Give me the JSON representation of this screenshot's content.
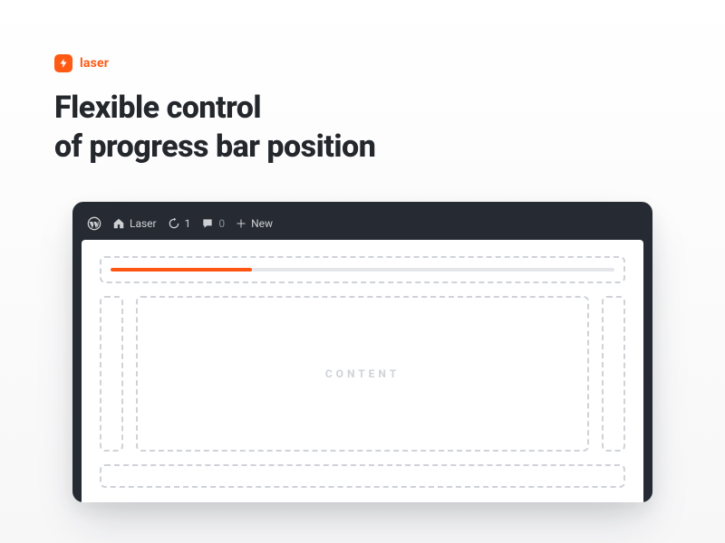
{
  "brand": {
    "name": "laser"
  },
  "headline": {
    "line1": "Flexible control",
    "line2": "of progress bar position"
  },
  "adminbar": {
    "site_name": "Laser",
    "updates_count": "1",
    "comments_count": "0",
    "new_label": "New"
  },
  "content": {
    "label": "CONTENT"
  },
  "progress": {
    "percent": 28
  },
  "colors": {
    "accent": "#ff5513"
  }
}
